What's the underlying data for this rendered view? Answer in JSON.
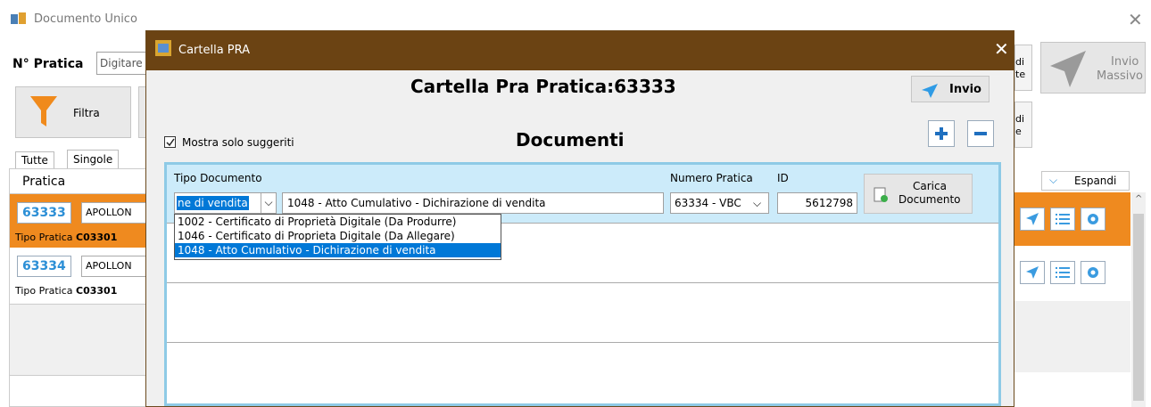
{
  "main": {
    "title": "Documento Unico",
    "n_pratica_label": "N° Pratica",
    "n_pratica_placeholder": "Digitare",
    "filter_label": "Filtra",
    "tabs": [
      "Tutte",
      "Singole"
    ],
    "pratica_header": "Pratica",
    "expand_label": "Espandi",
    "di_label_1": "di",
    "di_label_1b": "te",
    "di_label_2": "di",
    "di_label_2b": "e",
    "invio_massivo_1": "Invio",
    "invio_massivo_2": "Massivo",
    "rows": [
      {
        "id": "63333",
        "name": "APOLLON",
        "tipo_label": "Tipo Pratica",
        "tipo_value": "C03301",
        "highlight": true
      },
      {
        "id": "63334",
        "name": "APOLLON",
        "tipo_label": "Tipo Pratica",
        "tipo_value": "C03301",
        "highlight": false
      }
    ]
  },
  "dialog": {
    "title": "Cartella PRA",
    "heading_label": "Cartella Pra Pratica:",
    "heading_number": "63333",
    "invio_label": "Invio",
    "documenti_label": "Documenti",
    "mostra_label": "Mostra solo suggeriti",
    "mostra_checked": true,
    "columns": {
      "tipo": "Tipo Documento",
      "numero": "Numero Pratica",
      "id": "ID"
    },
    "row": {
      "tipo_combo_value": "ne di vendita",
      "tipo_text": "1048 - Atto Cumulativo - Dichirazione di vendita",
      "numero_value": "63334 - VBC",
      "id_value": "5612798",
      "carica_label_1": "Carica",
      "carica_label_2": "Documento"
    },
    "dropdown_options": [
      "1002 - Certificato di Proprietà Digitale (Da Produrre)",
      "1046 - Certificato di Proprieta Digitale (Da Allegare)",
      "1048 - Atto Cumulativo - Dichirazione di vendita"
    ],
    "selected_option_index": 2
  },
  "colors": {
    "dialog_title": "#6b4313",
    "accent_orange": "#ef8a1f",
    "selection_blue": "#0078d7",
    "panel_border": "#8ecae6",
    "id_blue": "#2c8fd6"
  }
}
